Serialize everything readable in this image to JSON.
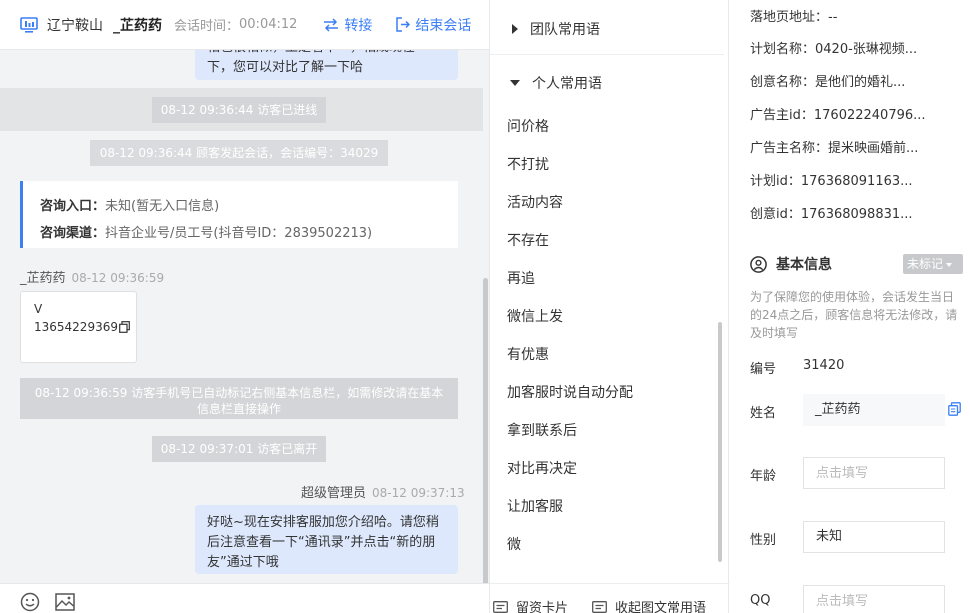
{
  "header": {
    "location": "辽宁鞍山",
    "visitor_name": "_芷药药",
    "time_label": "会话时间：",
    "time_value": "00:04:12",
    "transfer_label": "转接",
    "end_label": "结束会话"
  },
  "messages": {
    "top_bubble_line1": "相也很相似，王是看不一，相成现在",
    "top_bubble_line2": "下，您可以对比了解一下哈",
    "sys_entered": "08-12 09:36:44 访客已进线",
    "sys_started": "08-12 09:36:44 顾客发起会话，会话编号：34029",
    "entry_label": "咨询入口：",
    "entry_value": "未知(暂无入口信息)",
    "channel_label": "咨询渠道：",
    "channel_value": "抖音企业号/员工号(抖音号ID：2839502213)",
    "visitor_sender": "_芷药药",
    "visitor_time": "08-12 09:36:59",
    "phone_line1": "V",
    "phone_line2": "13654229369",
    "sys_marked": "08-12 09:36:59 访客手机号已自动标记右侧基本信息栏，如需修改请在基本信息栏直接操作",
    "sys_left": "08-12 09:37:01 访客已离开",
    "agent_sender": "超级管理员",
    "agent_time": "08-12 09:37:13",
    "agent_text": "好哒~现在安排客服加您介绍哈。请您稍后注意查看一下“通讯录”并点击“新的朋友”通过下哦"
  },
  "phrases": {
    "team_label": "团队常用语",
    "personal_label": "个人常用语",
    "items": [
      "问价格",
      "不打扰",
      "活动内容",
      "不存在",
      "再追",
      "微信上发",
      "有优惠",
      "加客服时说自动分配",
      "拿到联系后",
      "对比再决定",
      "让加客服",
      "微"
    ],
    "card_button": "留资卡片",
    "collapse_button": "收起图文常用语"
  },
  "info": {
    "landing_label": "落地页地址：",
    "landing_value": "--",
    "plan_name_label": "计划名称：",
    "plan_name_value": "0420-张琳视频...",
    "creative_name_label": "创意名称：",
    "creative_name_value": "是他们的婚礼...",
    "advertiser_id_label": "广告主id：",
    "advertiser_id_value": "176022240796...",
    "advertiser_name_label": "广告主名称：",
    "advertiser_name_value": "提米映画婚前...",
    "plan_id_label": "计划id：",
    "plan_id_value": "176368091163...",
    "creative_id_label": "创意id：",
    "creative_id_value": "176368098831...",
    "basic_title": "基本信息",
    "tag_label": "未标记",
    "note": "为了保障您的使用体验，会话发生当日的24点之后，顾客信息将无法修改，请及时填写",
    "number_label": "编号",
    "number_value": "31420",
    "name_label": "姓名",
    "name_value": "_芷药药",
    "age_label": "年龄",
    "age_placeholder": "点击填写",
    "gender_label": "性别",
    "gender_value": "未知",
    "qq_label": "QQ",
    "qq_placeholder": "点击填写"
  },
  "colors": {
    "accent": "#3b7ff5",
    "bubble": "#dde8fc",
    "system": "#d4d5d8"
  }
}
